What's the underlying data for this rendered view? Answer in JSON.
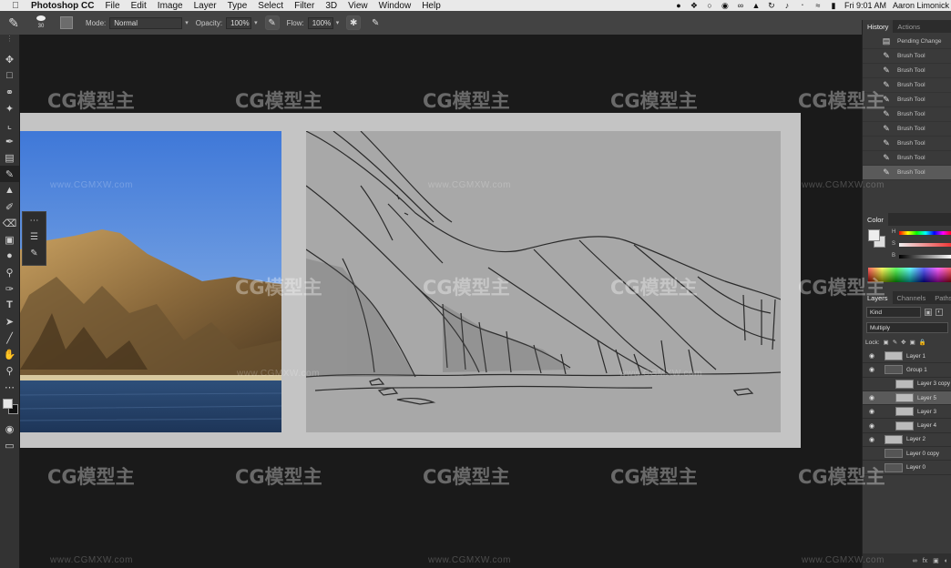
{
  "menubar": {
    "app_name": "Photoshop CC",
    "menus": [
      "File",
      "Edit",
      "Image",
      "Layer",
      "Type",
      "Select",
      "Filter",
      "3D",
      "View",
      "Window",
      "Help"
    ],
    "time": "Fri 9:01 AM",
    "user": "Aaron Limonick"
  },
  "options": {
    "brush_size": "30",
    "mode_label": "Mode:",
    "mode_value": "Normal",
    "opacity_label": "Opacity:",
    "opacity_value": "100%",
    "flow_label": "Flow:",
    "flow_value": "100%"
  },
  "history": {
    "tabs": [
      "History",
      "Actions"
    ],
    "items": [
      {
        "label": "Pending Change",
        "icon": "document-icon"
      },
      {
        "label": "Brush Tool",
        "icon": "brush-icon"
      },
      {
        "label": "Brush Tool",
        "icon": "brush-icon"
      },
      {
        "label": "Brush Tool",
        "icon": "brush-icon"
      },
      {
        "label": "Brush Tool",
        "icon": "brush-icon"
      },
      {
        "label": "Brush Tool",
        "icon": "brush-icon"
      },
      {
        "label": "Brush Tool",
        "icon": "brush-icon"
      },
      {
        "label": "Brush Tool",
        "icon": "brush-icon"
      },
      {
        "label": "Brush Tool",
        "icon": "brush-icon"
      },
      {
        "label": "Brush Tool",
        "icon": "brush-icon"
      }
    ],
    "selected_index": 9
  },
  "color_panel": {
    "title": "Color",
    "slider_labels": [
      "H",
      "S",
      "B"
    ]
  },
  "layers": {
    "tabs": [
      "Layers",
      "Channels",
      "Paths"
    ],
    "filter_kind": "Kind",
    "blend_mode": "Multiply",
    "lock_label": "Lock:",
    "items": [
      {
        "name": "Layer 1",
        "visible": true,
        "indent": false
      },
      {
        "name": "Group 1",
        "visible": true,
        "indent": false
      },
      {
        "name": "Layer 3 copy",
        "visible": false,
        "indent": true
      },
      {
        "name": "Layer 5",
        "visible": true,
        "indent": true
      },
      {
        "name": "Layer 3",
        "visible": true,
        "indent": true
      },
      {
        "name": "Layer 4",
        "visible": true,
        "indent": true
      },
      {
        "name": "Layer 2",
        "visible": true,
        "indent": false
      },
      {
        "name": "Layer 0 copy",
        "visible": false,
        "indent": false
      },
      {
        "name": "Layer 0",
        "visible": false,
        "indent": false
      }
    ],
    "selected_index": 3,
    "footer_icons": [
      "link-icon",
      "fx-icon",
      "mask-icon",
      "adjustment-icon"
    ]
  },
  "watermark": {
    "brand": "CG模型主",
    "url": "www.CGMXW.com"
  },
  "colors": {
    "menubar_bg": "#e9e9e9",
    "options_bg": "#434343",
    "panel_bg": "#3a3a3a",
    "canvas_bg": "#1a1a1a",
    "document_bg": "#c4c4c4",
    "sketch_bg": "#a8a8a8"
  }
}
